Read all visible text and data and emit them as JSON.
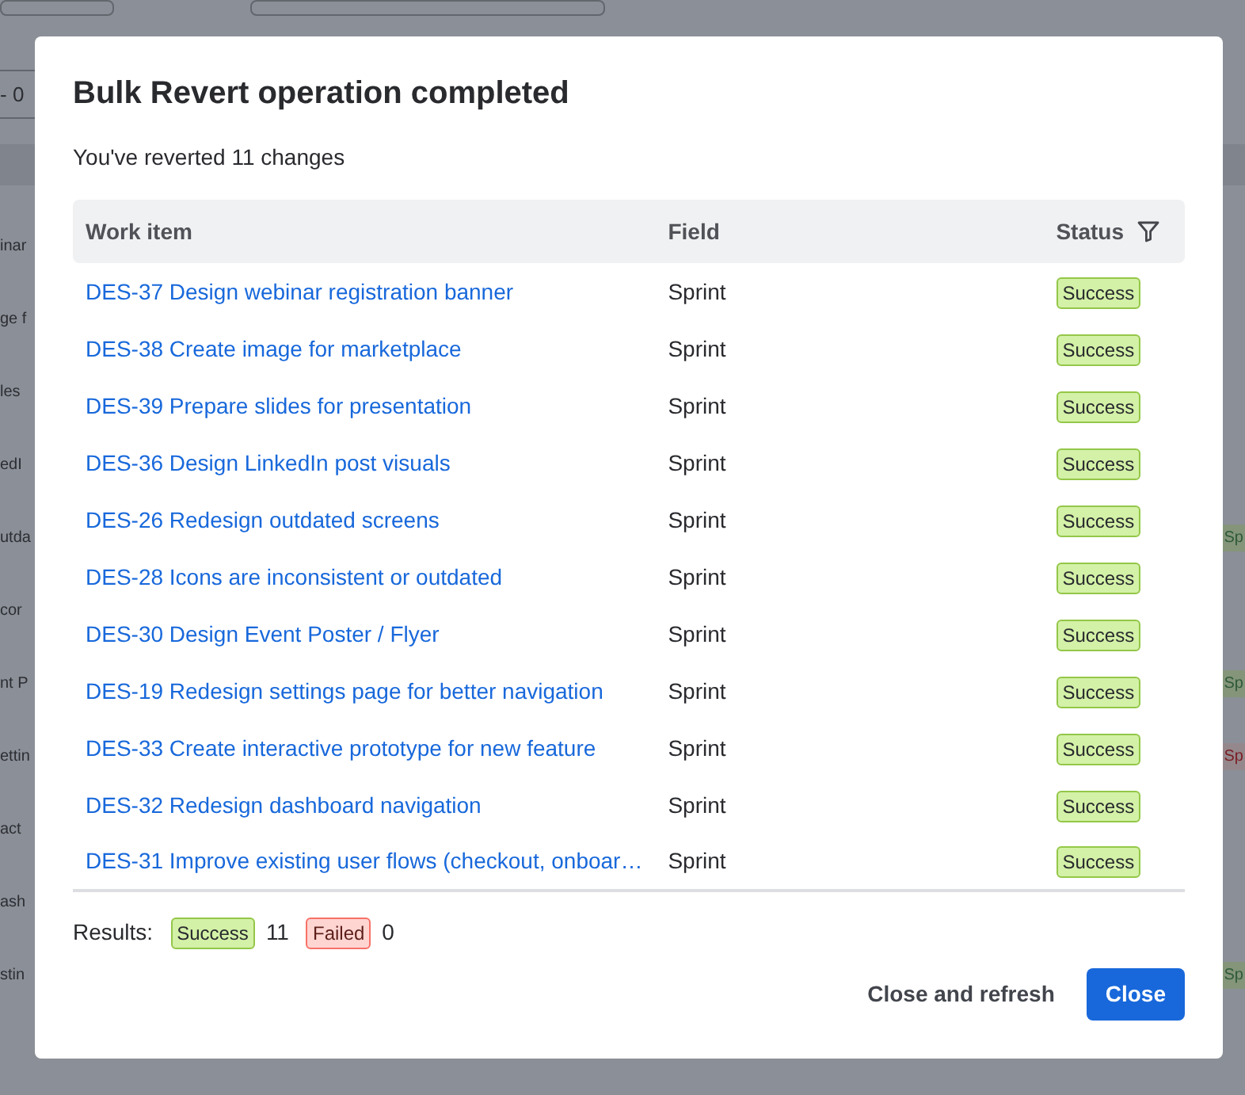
{
  "background": {
    "pager_text": "- 0",
    "rows": [
      {
        "fragment": "inar"
      },
      {
        "fragment": "ge f"
      },
      {
        "fragment": "les"
      },
      {
        "fragment": "edI"
      },
      {
        "fragment": "utda",
        "tag": {
          "text": "Sp",
          "kind": "success"
        }
      },
      {
        "fragment": "cor"
      },
      {
        "fragment": "nt P",
        "tag": {
          "text": "Sp",
          "kind": "success"
        }
      },
      {
        "fragment": "ettin",
        "tag": {
          "text": "Sp",
          "kind": "failed"
        }
      },
      {
        "fragment": "act"
      },
      {
        "fragment": "ash"
      },
      {
        "fragment": "stin",
        "tag": {
          "text": "Sp",
          "kind": "success"
        }
      }
    ]
  },
  "dialog": {
    "title": "Bulk Revert operation completed",
    "subtitle": "You've reverted 11 changes",
    "table": {
      "columns": [
        {
          "label": "Work item"
        },
        {
          "label": "Field"
        },
        {
          "label": "Status",
          "filter": true
        }
      ],
      "rows": [
        {
          "work_item": "DES-37 Design webinar registration banner",
          "field": "Sprint",
          "status": {
            "label": "Success",
            "kind": "success"
          }
        },
        {
          "work_item": "DES-38 Create image for marketplace",
          "field": "Sprint",
          "status": {
            "label": "Success",
            "kind": "success"
          }
        },
        {
          "work_item": "DES-39 Prepare slides for presentation",
          "field": "Sprint",
          "status": {
            "label": "Success",
            "kind": "success"
          }
        },
        {
          "work_item": "DES-36 Design LinkedIn post visuals",
          "field": "Sprint",
          "status": {
            "label": "Success",
            "kind": "success"
          }
        },
        {
          "work_item": "DES-26 Redesign outdated screens",
          "field": "Sprint",
          "status": {
            "label": "Success",
            "kind": "success"
          }
        },
        {
          "work_item": "DES-28 Icons are inconsistent or outdated",
          "field": "Sprint",
          "status": {
            "label": "Success",
            "kind": "success"
          }
        },
        {
          "work_item": "DES-30 Design Event Poster / Flyer",
          "field": "Sprint",
          "status": {
            "label": "Success",
            "kind": "success"
          }
        },
        {
          "work_item": "DES-19 Redesign settings page for better navigation",
          "field": "Sprint",
          "status": {
            "label": "Success",
            "kind": "success"
          }
        },
        {
          "work_item": "DES-33 Create interactive prototype for new feature",
          "field": "Sprint",
          "status": {
            "label": "Success",
            "kind": "success"
          }
        },
        {
          "work_item": "DES-32 Redesign dashboard navigation",
          "field": "Sprint",
          "status": {
            "label": "Success",
            "kind": "success"
          }
        },
        {
          "work_item": "DES-31 Improve existing user flows (checkout, onboar…",
          "field": "Sprint",
          "status": {
            "label": "Success",
            "kind": "success"
          }
        }
      ]
    },
    "results": {
      "label": "Results:",
      "items": [
        {
          "label": "Success",
          "kind": "success",
          "count": "11"
        },
        {
          "label": "Failed",
          "kind": "failed",
          "count": "0"
        }
      ]
    },
    "buttons": [
      {
        "label": "Close and refresh",
        "kind": "subtle"
      },
      {
        "label": "Close",
        "kind": "primary"
      }
    ]
  }
}
